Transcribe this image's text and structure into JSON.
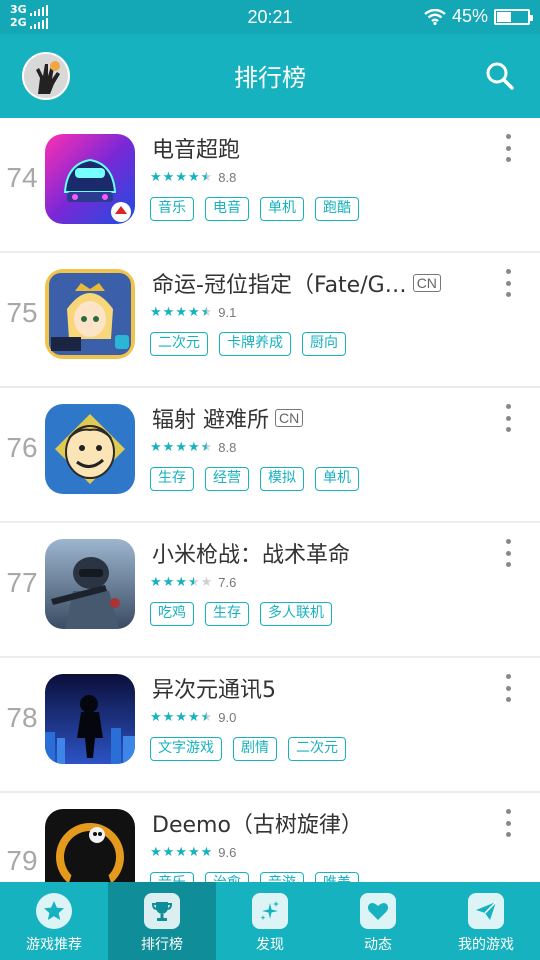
{
  "status_bar": {
    "network_top": "3G",
    "network_bottom": "2G",
    "time": "20:21",
    "battery": "45%",
    "battery_level": 0.45
  },
  "header": {
    "title": "排行榜"
  },
  "games": [
    {
      "rank": "74",
      "name": "电音超跑",
      "cn": "",
      "score": "8.8",
      "stars": 4.5,
      "tags": [
        "音乐",
        "电音",
        "单机",
        "跑酷"
      ]
    },
    {
      "rank": "75",
      "name": "命运-冠位指定（Fate/G…",
      "cn": "CN",
      "score": "9.1",
      "stars": 4.5,
      "tags": [
        "二次元",
        "卡牌养成",
        "厨向"
      ]
    },
    {
      "rank": "76",
      "name": "辐射 避难所",
      "cn": "CN",
      "score": "8.8",
      "stars": 4.5,
      "tags": [
        "生存",
        "经营",
        "模拟",
        "单机"
      ]
    },
    {
      "rank": "77",
      "name": "小米枪战：战术革命",
      "cn": "",
      "score": "7.6",
      "stars": 3.5,
      "tags": [
        "吃鸡",
        "生存",
        "多人联机"
      ]
    },
    {
      "rank": "78",
      "name": "异次元通讯5",
      "cn": "",
      "score": "9.0",
      "stars": 4.5,
      "tags": [
        "文字游戏",
        "剧情",
        "二次元"
      ]
    },
    {
      "rank": "79",
      "name": "Deemo（古树旋律）",
      "cn": "",
      "score": "9.6",
      "stars": 5,
      "tags": [
        "音乐",
        "治愈",
        "音游",
        "唯美"
      ]
    }
  ],
  "bottom_nav": {
    "items": [
      {
        "label": "游戏推荐",
        "icon": "star-icon"
      },
      {
        "label": "排行榜",
        "icon": "trophy-icon"
      },
      {
        "label": "发现",
        "icon": "sparkle-icon"
      },
      {
        "label": "动态",
        "icon": "heart-icon"
      },
      {
        "label": "我的游戏",
        "icon": "paper-plane-icon"
      }
    ],
    "active_index": 1
  },
  "colors": {
    "primary": "#17b2bf",
    "status_bar": "#14a7b5",
    "active_tab": "#0f8e9a"
  }
}
